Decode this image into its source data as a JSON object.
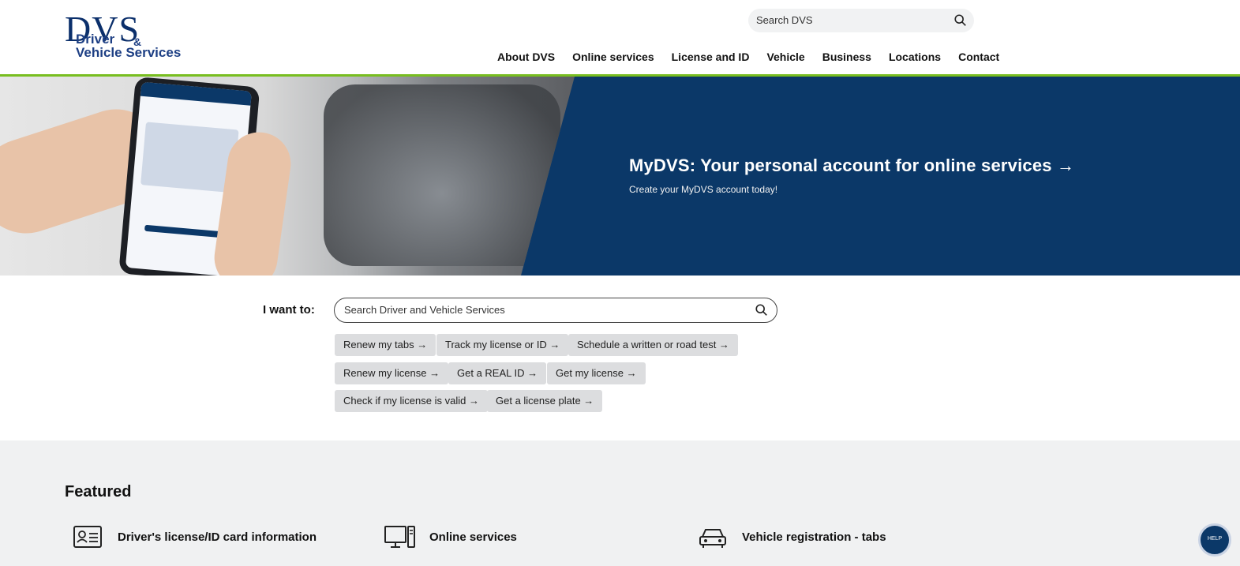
{
  "header": {
    "logo": {
      "big": "DVS",
      "line1": "Driver",
      "amp": "&",
      "line2": "Vehicle Services"
    },
    "search_placeholder": "Search DVS",
    "nav": [
      "About DVS",
      "Online services",
      "License and ID",
      "Vehicle",
      "Business",
      "Locations",
      "Contact"
    ]
  },
  "hero": {
    "title": "MyDVS: Your personal account for online services →",
    "subtitle": "Create your MyDVS account today!"
  },
  "want": {
    "label": "I want to:",
    "placeholder": "Search Driver and Vehicle Services",
    "chips": [
      "Renew my tabs →",
      "Track my license or ID →",
      "Schedule a written or road test →",
      "Renew my license →",
      "Get a REAL ID →",
      "Get my license →",
      "Check if my license is valid →",
      "Get a license plate →"
    ]
  },
  "featured": {
    "title": "Featured",
    "items": [
      {
        "label": "Driver's license/ID card information",
        "icon": "id-card-icon"
      },
      {
        "label": "Online services",
        "icon": "computer-icon"
      },
      {
        "label": "Vehicle registration - tabs",
        "icon": "car-icon"
      }
    ]
  },
  "help_widget": "HELP",
  "colors": {
    "brand_navy": "#0b3868",
    "accent_green": "#78be20",
    "chip_gray": "#dcdddf"
  }
}
